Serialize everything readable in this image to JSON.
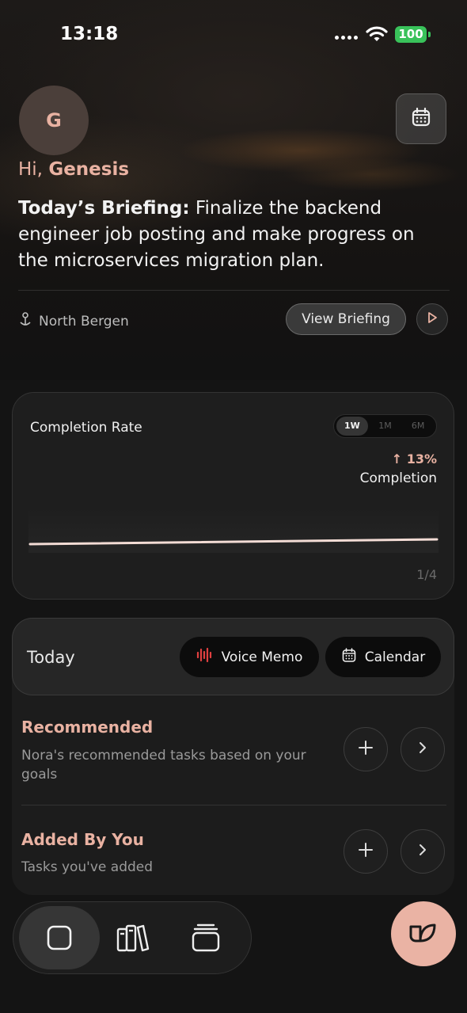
{
  "status_bar": {
    "time": "13:18",
    "battery": "100"
  },
  "header": {
    "avatar_initial": "G",
    "greeting_prefix": "Hi,",
    "user_name": "Genesis",
    "briefing_label": "Today’s Briefing:",
    "briefing_text": "Finalize the backend engineer job posting and make progress on the microservices migration plan.",
    "location": "North Bergen",
    "view_briefing_label": "View Briefing"
  },
  "completion": {
    "title": "Completion Rate",
    "ranges": [
      "1W",
      "1M",
      "6M"
    ],
    "selected_range": "1W",
    "change": "13%",
    "change_label": "Completion",
    "page_indicator": "1/4"
  },
  "today": {
    "label": "Today",
    "voice_memo_label": "Voice Memo",
    "calendar_label": "Calendar",
    "sections": [
      {
        "title": "Recommended",
        "description": "Nora's recommended tasks based on your goals"
      },
      {
        "title": "Added By You",
        "description": "Tasks you've added"
      }
    ]
  },
  "colors": {
    "accent": "#e9b2a2",
    "background": "#141414",
    "voice_icon": "#e04040"
  },
  "icons": [
    "calendar-icon",
    "location-pin-icon",
    "play-icon",
    "waveform-icon",
    "plus-icon",
    "chevron-right-icon",
    "square-icon",
    "library-icon",
    "stack-icon",
    "assistant-logo-icon"
  ]
}
